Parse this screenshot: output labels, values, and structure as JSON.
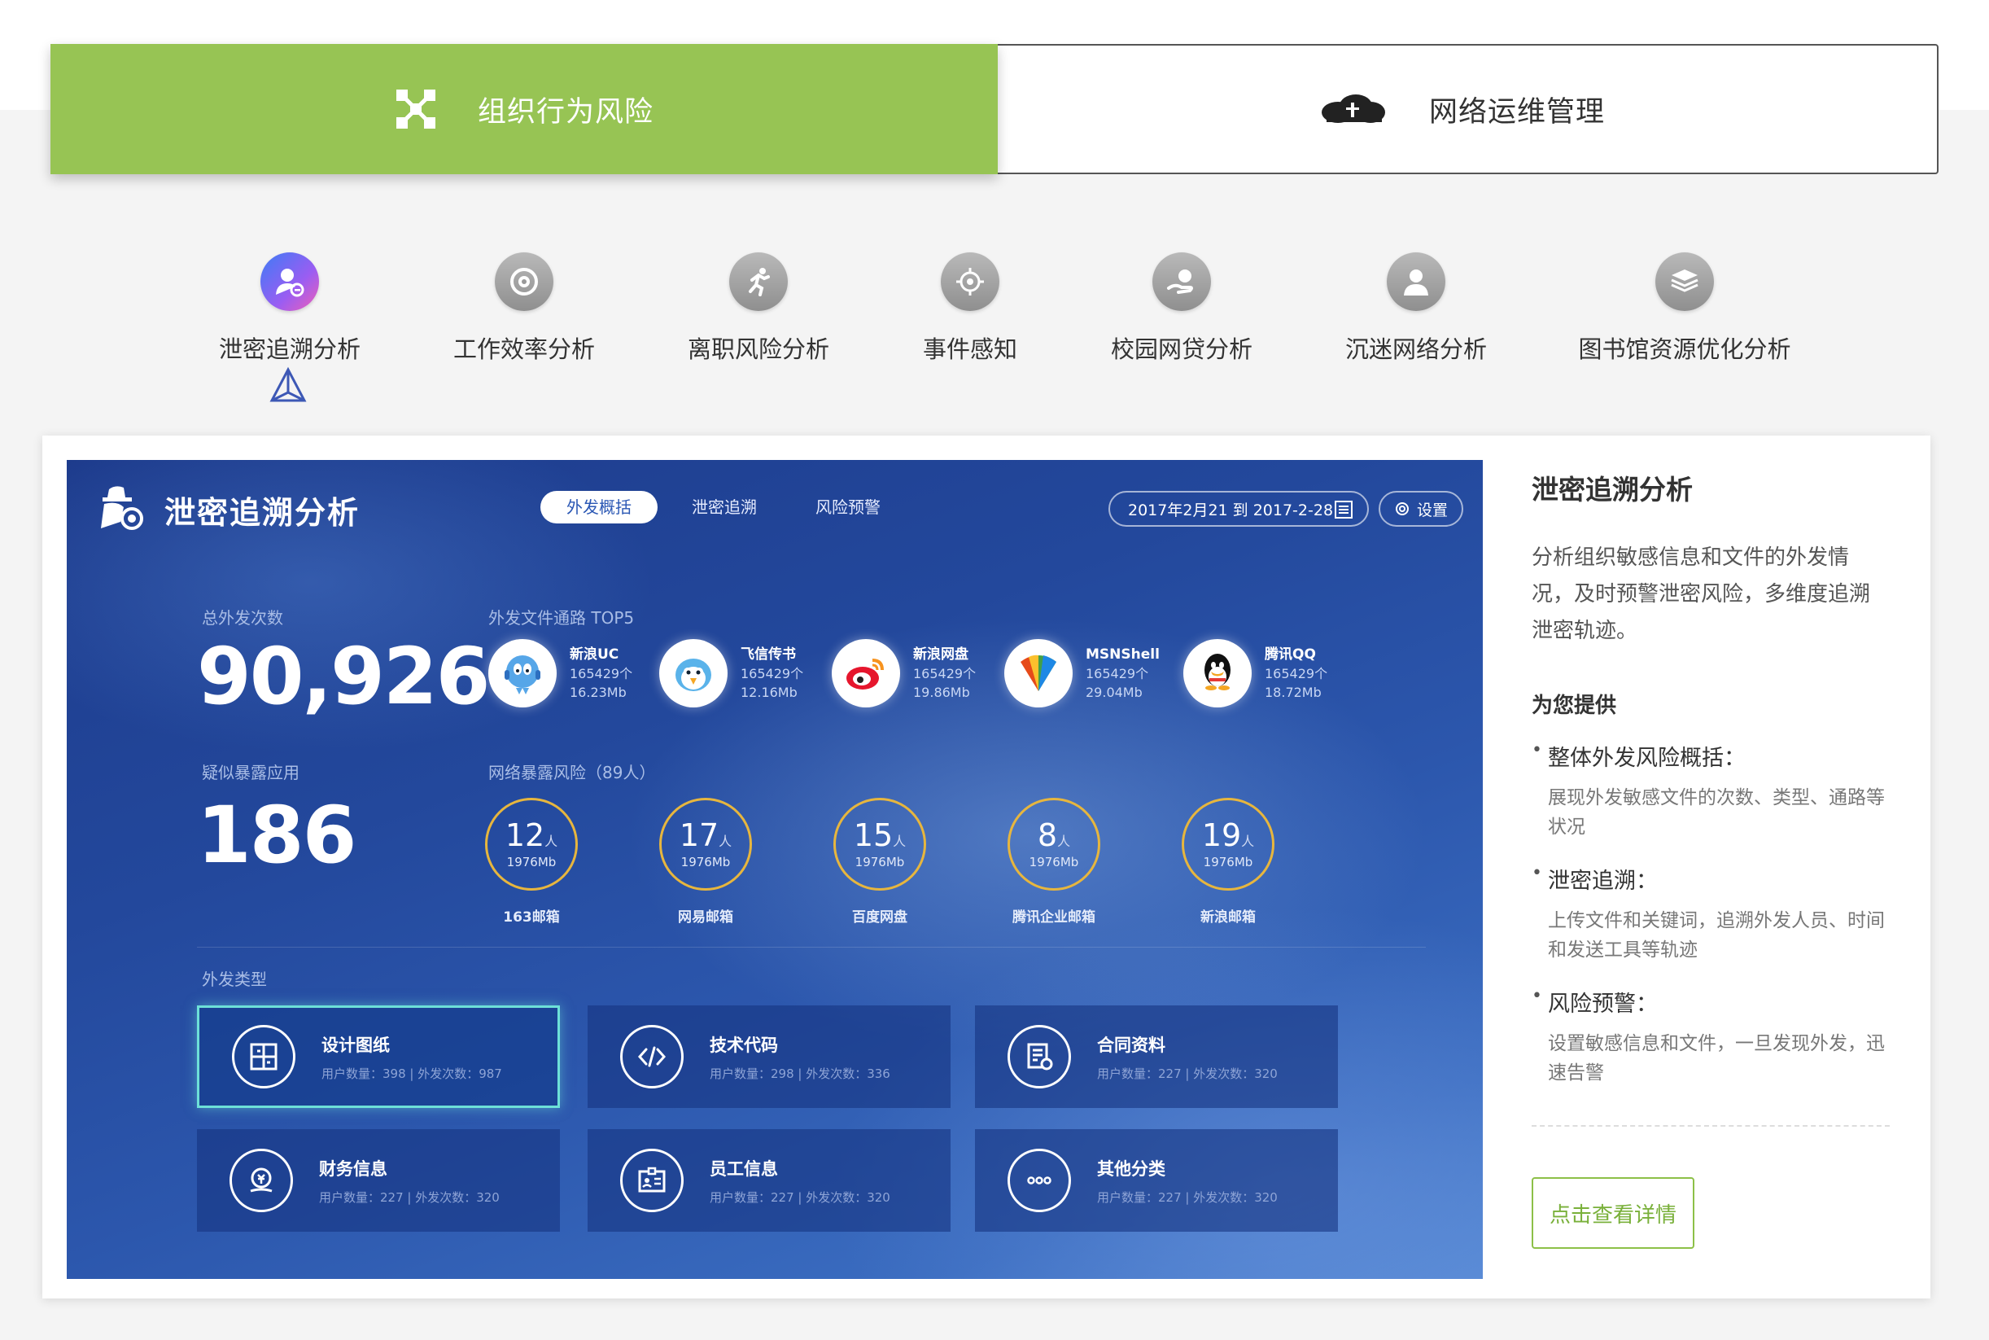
{
  "main_tabs": [
    {
      "label": "组织行为风险",
      "icon": "network-nodes-icon",
      "active": true
    },
    {
      "label": "网络运维管理",
      "icon": "cloud-icon",
      "active": false
    }
  ],
  "features": [
    {
      "label": "泄密追溯分析",
      "icon": "user-search-icon",
      "active": true
    },
    {
      "label": "工作效率分析",
      "icon": "clock-icon"
    },
    {
      "label": "离职风险分析",
      "icon": "running-person-icon"
    },
    {
      "label": "事件感知",
      "icon": "target-icon"
    },
    {
      "label": "校园网贷分析",
      "icon": "hand-coin-icon"
    },
    {
      "label": "沉迷网络分析",
      "icon": "user-icon"
    },
    {
      "label": "图书馆资源优化分析",
      "icon": "books-icon"
    }
  ],
  "dashboard": {
    "title": "泄密追溯分析",
    "tabs": [
      "外发概括",
      "泄密追溯",
      "风险预警"
    ],
    "date_range": "2017年2月21 到 2017-2-28",
    "settings_label": "设置",
    "total_label": "总外发次数",
    "total_value": "90,926",
    "channels_label": "外发文件通路 TOP5",
    "channels": [
      {
        "name": "新浪UC",
        "count": "165429个",
        "size": "16.23Mb",
        "icon": "sina-uc-icon"
      },
      {
        "name": "飞信传书",
        "count": "165429个",
        "size": "12.16Mb",
        "icon": "fetion-icon"
      },
      {
        "name": "新浪网盘",
        "count": "165429个",
        "size": "19.86Mb",
        "icon": "weibo-icon"
      },
      {
        "name": "MSNShell",
        "count": "165429个",
        "size": "29.04Mb",
        "icon": "msn-icon"
      },
      {
        "name": "腾讯QQ",
        "count": "165429个",
        "size": "18.72Mb",
        "icon": "qq-icon"
      }
    ],
    "suspect_label": "疑似暴露应用",
    "suspect_value": "186",
    "risk_label": "网络暴露风险（89人）",
    "risks": [
      {
        "count": "12",
        "unit": "人",
        "size": "1976Mb",
        "name": "163邮箱"
      },
      {
        "count": "17",
        "unit": "人",
        "size": "1976Mb",
        "name": "网易邮箱"
      },
      {
        "count": "15",
        "unit": "人",
        "size": "1976Mb",
        "name": "百度网盘"
      },
      {
        "count": "8",
        "unit": "人",
        "size": "1976Mb",
        "name": "腾讯企业邮箱"
      },
      {
        "count": "19",
        "unit": "人",
        "size": "1976Mb",
        "name": "新浪邮箱"
      }
    ],
    "types_label": "外发类型",
    "types": [
      {
        "name": "设计图纸",
        "stats": "用户数量：398  |  外发次数：987",
        "icon": "blueprint-icon",
        "active": true
      },
      {
        "name": "技术代码",
        "stats": "用户数量：298  |  外发次数：336",
        "icon": "code-icon"
      },
      {
        "name": "合同资料",
        "stats": "用户数量：227  |  外发次数：320",
        "icon": "contract-icon"
      },
      {
        "name": "财务信息",
        "stats": "用户数量：227  |  外发次数：320",
        "icon": "finance-icon"
      },
      {
        "name": "员工信息",
        "stats": "用户数量：227  |  外发次数：320",
        "icon": "id-card-icon"
      },
      {
        "name": "其他分类",
        "stats": "用户数量：227  |  外发次数：320",
        "icon": "more-icon"
      }
    ]
  },
  "side": {
    "title": "泄密追溯分析",
    "description": "分析组织敏感信息和文件的外发情况，及时预警泄密风险，多维度追溯泄密轨迹。",
    "provide_label": "为您提供",
    "features": [
      {
        "title": "整体外发风险概括：",
        "desc": "展现外发敏感文件的次数、类型、通路等状况"
      },
      {
        "title": "泄密追溯：",
        "desc": "上传文件和关键词，追溯外发人员、时间和发送工具等轨迹"
      },
      {
        "title": "风险预警：",
        "desc": "设置敏感信息和文件，一旦发现外发，迅速告警"
      }
    ],
    "detail_button": "点击查看详情"
  },
  "colors": {
    "accent_green": "#97c454",
    "ring_gold": "#e7b63e",
    "active_glow": "#6de0d8"
  }
}
